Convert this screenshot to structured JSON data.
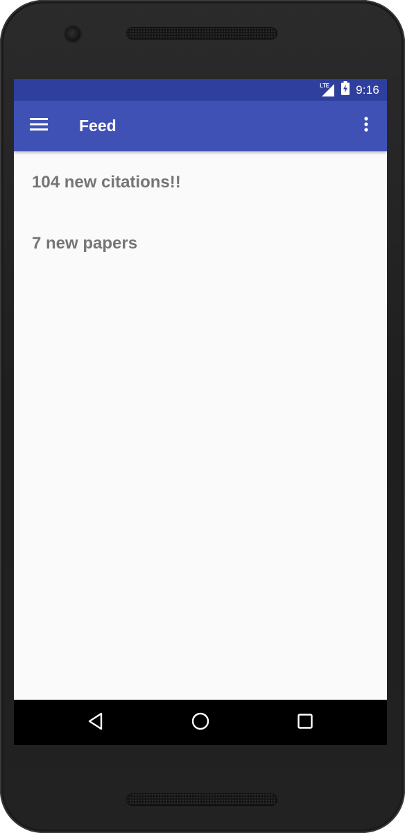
{
  "status_bar": {
    "network_label": "LTE",
    "time": "9:16",
    "icons": [
      "lte-signal-icon",
      "battery-charging-icon"
    ]
  },
  "app_bar": {
    "title": "Feed",
    "nav_icon": "hamburger-menu-icon",
    "action_icon": "overflow-menu-icon"
  },
  "feed": {
    "items": [
      {
        "text": "104 new citations!!"
      },
      {
        "text": "7 new papers"
      }
    ]
  },
  "nav_bar": {
    "icons": [
      "back-icon",
      "home-icon",
      "recents-icon"
    ]
  },
  "colors": {
    "status_bar": "#2f3f9e",
    "app_bar": "#3f51b5",
    "background": "#fafafa",
    "feed_text": "#757575",
    "nav_bar": "#000000"
  }
}
